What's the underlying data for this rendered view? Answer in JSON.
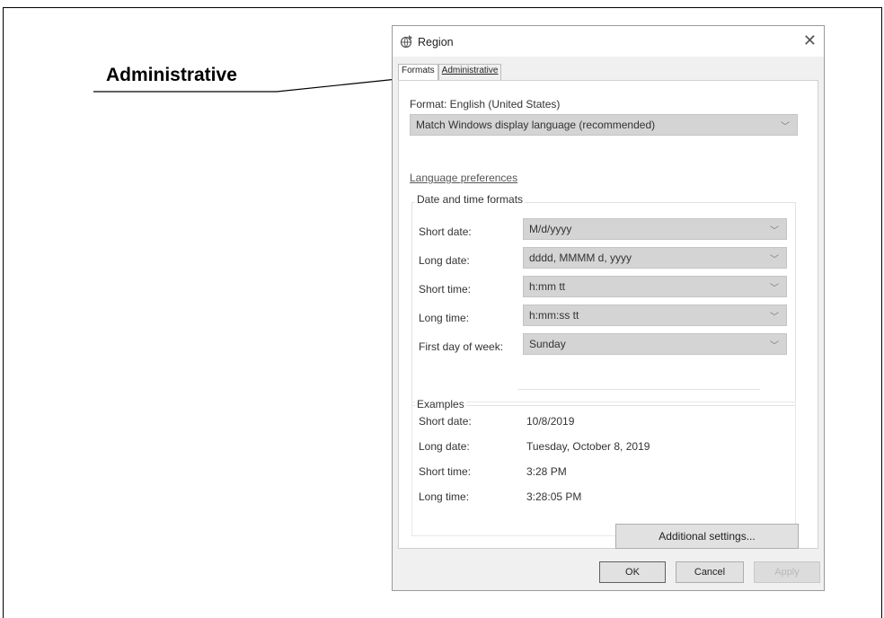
{
  "callout": {
    "label": "Administrative"
  },
  "dialog": {
    "title": "Region",
    "tabs": [
      {
        "label": "Formats",
        "active": true
      },
      {
        "label": "Administrative",
        "active": false
      }
    ],
    "format_label": "Format: English (United States)",
    "format_value": "Match Windows display language (recommended)",
    "language_link": "Language preferences",
    "date_time_group": "Date and time formats",
    "fields": [
      {
        "label": "Short date:",
        "value": "M/d/yyyy"
      },
      {
        "label": "Long date:",
        "value": "dddd, MMMM d, yyyy"
      },
      {
        "label": "Short time:",
        "value": "h:mm tt"
      },
      {
        "label": "Long time:",
        "value": "h:mm:ss tt"
      },
      {
        "label": "First day of week:",
        "value": "Sunday"
      }
    ],
    "examples_title": "Examples",
    "examples": [
      {
        "label": "Short date:",
        "value": "10/8/2019"
      },
      {
        "label": "Long date:",
        "value": "Tuesday, October 8, 2019"
      },
      {
        "label": "Short time:",
        "value": "3:28 PM"
      },
      {
        "label": "Long time:",
        "value": "3:28:05 PM"
      }
    ],
    "additional_settings": "Additional settings...",
    "ok": "OK",
    "cancel": "Cancel",
    "apply": "Apply"
  }
}
